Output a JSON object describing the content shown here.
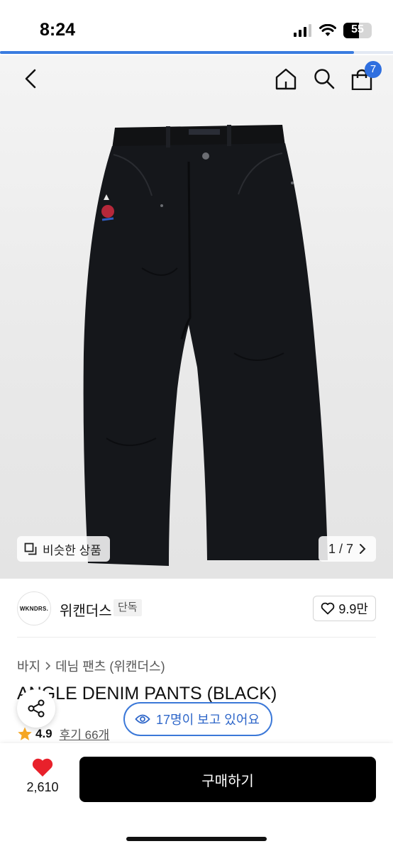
{
  "status_bar": {
    "time": "8:24",
    "battery_level": "55"
  },
  "page_load_progress": 0.9,
  "header": {
    "cart_count": "7"
  },
  "gallery": {
    "similar_products_label": "비슷한 상품",
    "page_counter": "1 / 7"
  },
  "brand": {
    "logo_text": "WKNDRS.",
    "name": "위캔더스",
    "exclusive_label": "단독",
    "like_count": "9.9만"
  },
  "product": {
    "breadcrumb": [
      "바지",
      "데님 팬츠 (위캔더스)"
    ],
    "title": "ANGLE DENIM PANTS (BLACK)",
    "rating": "4.9",
    "reviews": "후기 66개"
  },
  "viewers": {
    "label": "17명이 보고 있어요"
  },
  "bottom_bar": {
    "wish_count": "2,610",
    "buy_label": "구매하기"
  },
  "colors": {
    "accent": "#3a7ce0",
    "heart": "#e8212b",
    "star": "#f5a623",
    "buy_button": "#000000"
  },
  "icons": [
    "back-icon",
    "home-icon",
    "search-icon",
    "cart-icon",
    "similar-icon",
    "chevron-right-icon",
    "heart-outline-icon",
    "share-icon",
    "eye-icon",
    "star-icon",
    "heart-filled-icon"
  ]
}
